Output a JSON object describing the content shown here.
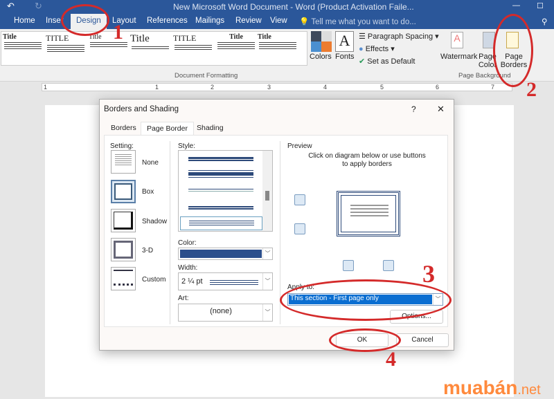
{
  "window": {
    "title": "New Microsoft Word Document - Word (Product Activation Faile..."
  },
  "tabs": [
    "Home",
    "Inser",
    "Design",
    "Layout",
    "References",
    "Mailings",
    "Review",
    "View"
  ],
  "tell_me": "Tell me what you want to do...",
  "ribbon": {
    "gallery": [
      "Title",
      "TITLE",
      "Title",
      "Title",
      "TITLE",
      "Title",
      "Title"
    ],
    "colors": "Colors",
    "fonts": "Fonts",
    "paragraph_spacing": "Paragraph Spacing",
    "effects": "Effects",
    "set_default": "Set as Default",
    "watermark": "Watermark",
    "page_color": "Page Color",
    "page_borders": "Page Borders",
    "group_doc": "Document Formatting",
    "group_bg": "Page Background"
  },
  "ruler_labels": [
    "1",
    "1",
    "2",
    "3",
    "4",
    "5",
    "6",
    "7"
  ],
  "dialog": {
    "title": "Borders and Shading",
    "help": "?",
    "close": "✕",
    "tabs": [
      "Borders",
      "Page Border",
      "Shading"
    ],
    "setting_label": "Setting:",
    "settings": [
      "None",
      "Box",
      "Shadow",
      "3-D",
      "Custom"
    ],
    "style_label": "Style:",
    "color_label": "Color:",
    "color_value": "#2c4f8c",
    "width_label": "Width:",
    "width_value": "2 ¼ pt",
    "art_label": "Art:",
    "art_value": "(none)",
    "preview_label": "Preview",
    "preview_hint": "Click on diagram below or use buttons to apply borders",
    "apply_to_label": "Apply to:",
    "apply_to_value": "This section - First page only",
    "options": "Options...",
    "ok": "OK",
    "cancel": "Cancel"
  },
  "annotations": [
    "1",
    "2",
    "3",
    "4"
  ],
  "watermark": {
    "main": "muabán",
    "suffix": ".net"
  }
}
